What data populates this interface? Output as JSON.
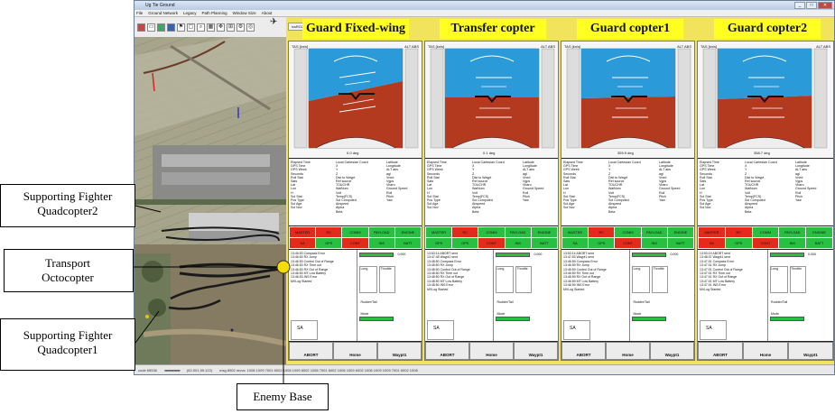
{
  "window": {
    "title": "Ug Tie Ground"
  },
  "menu": [
    "File",
    "Ground Network",
    "Legacy",
    "Path Planning",
    "Window Size",
    "About"
  ],
  "tab_label": "icsRO2",
  "status": {
    "left": "code 65536",
    "mid": "(62.001,99.122)",
    "bottom": "msg 8902 recvs: 1008 1009 7001 6002 1008 1009 6002 1008 7001 6002 1008 1009 6002 1008 1009 1009 7001 6002 1008"
  },
  "panels": [
    {
      "title": "Guard Fixed-wing",
      "mode_value": "0.0",
      "mode_unit": "deg",
      "log": [
        "13:46:53 Compass Error",
        "13:46:53 RX Jump",
        "13:46:53 Control Out of Range",
        "13:46:53 RX Time out",
        "13:46:53 RX Out of Range",
        "13:46:53 MT Low Battery",
        "13:46:53 INS Error",
        "MVLog Started"
      ],
      "grid": [
        [
          "MASTER",
          "r"
        ],
        [
          "RC",
          "r"
        ],
        [
          "COMM",
          "g"
        ],
        [
          "PAYLOAD",
          "g"
        ],
        [
          "ENGINE",
          "g"
        ],
        [
          "SA",
          "r"
        ],
        [
          "GPS",
          "g"
        ],
        [
          "CONT",
          "r"
        ],
        [
          "INS",
          "g"
        ],
        [
          "BATT",
          "g"
        ]
      ]
    },
    {
      "title": "Transfer copter",
      "mode_value": "0.1",
      "mode_unit": "deg",
      "log": [
        "13:53:14 ABORT sent",
        "13:47:45 Waypt1 sent",
        "13:48:50 Compass Error",
        "13:48:50 RX Jump",
        "13:48:50 Control Out of Range",
        "13:48:50 RX Time out",
        "13:48:50 RX Out of Range",
        "13:48:50 MT Low Battery",
        "13:48:50 INS Error",
        "MVLog Started"
      ],
      "grid": [
        [
          "MASTER",
          "g"
        ],
        [
          "RC",
          "r"
        ],
        [
          "COMM",
          "g"
        ],
        [
          "PAYLOAD",
          "g"
        ],
        [
          "ENGINE",
          "g"
        ],
        [
          "GPS",
          "g"
        ],
        [
          "GPS",
          "g"
        ],
        [
          "CONT",
          "r"
        ],
        [
          "INS",
          "g"
        ],
        [
          "BATT",
          "g"
        ]
      ]
    },
    {
      "title": "Guard copter1",
      "mode_value": "359.9",
      "mode_unit": "deg",
      "log": [
        "13:53:14 ABORT sent",
        "13:47:53 Waypt1 sent",
        "13:46:59 Compass Error",
        "13:46:59 RX Jump",
        "13:46:59 Control Out of Range",
        "13:46:59 RX Time out",
        "13:46:59 RX Out of Range",
        "13:46:59 MT Low Battery",
        "13:46:59 INS Error",
        "MVLog Started"
      ],
      "grid": [
        [
          "MASTER",
          "g"
        ],
        [
          "RC",
          "r"
        ],
        [
          "COMM",
          "g"
        ],
        [
          "PAYLOAD",
          "g"
        ],
        [
          "ENGINE",
          "g"
        ],
        [
          "SA",
          "g"
        ],
        [
          "GPS",
          "g"
        ],
        [
          "CONT",
          "r"
        ],
        [
          "INS",
          "g"
        ],
        [
          "BATT",
          "g"
        ]
      ]
    },
    {
      "title": "Guard copter2",
      "mode_value": "358.7",
      "mode_unit": "deg",
      "log": [
        "13:53:19 ABORT sent",
        "13:48:37 Waypt1 sent",
        "13:47:01 Compass Error",
        "13:47:01 RX Jump",
        "13:47:01 Control Out of Range",
        "13:47:01 RX Time out",
        "13:47:01 RX Out of Range",
        "13:47:01 MT Low Battery",
        "13:47:01 INS Error",
        "MVLog Started"
      ],
      "grid": [
        [
          "MASTER",
          "r"
        ],
        [
          "RC",
          "r"
        ],
        [
          "COMM",
          "g"
        ],
        [
          "PAYLOAD",
          "g"
        ],
        [
          "ENGINE",
          "g"
        ],
        [
          "SA",
          "r"
        ],
        [
          "GPS",
          "g"
        ],
        [
          "CONT",
          "r"
        ],
        [
          "INS",
          "g"
        ],
        [
          "BATT",
          "g"
        ]
      ]
    }
  ],
  "adi": {
    "tas": "TAS [kn/s]",
    "alt": "ALT ABS"
  },
  "fields": {
    "col1": [
      "Elapsed Time",
      "GPS Time",
      "GPS Week",
      "Seconds",
      "Roll Stat",
      "Sats",
      "Lat",
      "Lon",
      "H",
      "Sol Stat",
      "Pos Type",
      "Sol Age",
      "Sol Nov"
    ],
    "col2": [
      "Local Cartesian Coord",
      "X",
      "Y",
      "Z",
      "Dist to Waypt",
      "Ref source",
      "TOUCHR",
      "WaiNum",
      "Volt",
      "Temp(FCS)",
      "Sol Computed",
      "Airspeed",
      "Alpha",
      "Beta"
    ],
    "col3": [
      "Latitude",
      "Longitude",
      "ALT abs",
      "agl",
      "Vned",
      "Vgps",
      "Vbaro",
      "Ground Speed",
      "Roll",
      "Pitch",
      "Yaw"
    ]
  },
  "controls": {
    "throttle": "Throttle",
    "rudder_tail": "Rudder/Tail",
    "mode": "Mode",
    "long": "Long",
    "lat": "Lat",
    "cell_value": "0.000"
  },
  "buttons": {
    "abort": "ABORT",
    "home": "Home",
    "waypt": "Waypt1",
    "sa": "SA"
  },
  "annotations": {
    "fighter2": "Supporting Fighter Quadcopter2",
    "transport": "Transport Octocopter",
    "fighter1": "Supporting Fighter Quadcopter1",
    "enemy": "Enemy Base"
  },
  "colors": {
    "sky": "#2a9bd8",
    "ground": "#b3391f",
    "title_bg": "#ffff22",
    "ok": "#27c040",
    "alarm": "#e42a1a",
    "marker": "#f5dd00"
  }
}
